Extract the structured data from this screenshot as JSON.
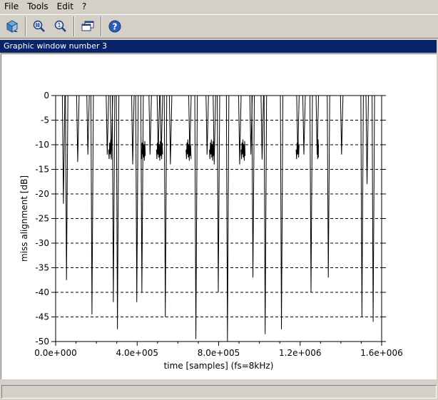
{
  "menu": [
    "File",
    "Tools",
    "Edit",
    "?"
  ],
  "toolbar": {
    "buttons": [
      "rotate-3d-icon",
      "zoom-icon",
      "unzoom-icon",
      "gedit-windows-icon",
      "help-icon"
    ]
  },
  "window_title": "Graphic window number 3",
  "status": "",
  "chart_data": {
    "type": "line",
    "title": "",
    "xlabel": "time [samples] (fs=8kHz)",
    "ylabel": "miss alignment [dB]",
    "xlim": [
      0,
      1600000
    ],
    "ylim": [
      -50,
      0
    ],
    "x_ticks": [
      0,
      400000,
      800000,
      1200000,
      1600000
    ],
    "x_tick_labels": [
      "0.0e+000",
      "4.0e+005",
      "8.0e+005",
      "1.2e+006",
      "1.6e+006"
    ],
    "y_ticks": [
      0,
      -5,
      -10,
      -15,
      -20,
      -25,
      -30,
      -35,
      -40,
      -45,
      -50
    ],
    "y_tick_labels": [
      "0",
      "-5",
      "-10",
      "-15",
      "-20",
      "-25",
      "-30",
      "-35",
      "-40",
      "-45",
      "-50"
    ],
    "grid": "horizontal dashed",
    "series": [
      {
        "color": "#000000",
        "spikes": [
          {
            "x": 40000,
            "min": -22
          },
          {
            "x": 55000,
            "min": -37.5
          },
          {
            "x": 110000,
            "min": -13.5
          },
          {
            "x": 160000,
            "min": -12
          },
          {
            "x": 180000,
            "min": -44.5
          },
          {
            "x": 255000,
            "min": -12
          },
          {
            "x": 275000,
            "min": -13
          },
          {
            "x": 285000,
            "min": -42
          },
          {
            "x": 305000,
            "min": -47.5
          },
          {
            "x": 380000,
            "min": -14
          },
          {
            "x": 400000,
            "min": -42
          },
          {
            "x": 425000,
            "min": -40
          },
          {
            "x": 465000,
            "min": -12
          },
          {
            "x": 505000,
            "min": -12
          },
          {
            "x": 520000,
            "min": -12
          },
          {
            "x": 540000,
            "min": -45
          },
          {
            "x": 565000,
            "min": -14
          },
          {
            "x": 660000,
            "min": -12
          },
          {
            "x": 690000,
            "min": -49.5
          },
          {
            "x": 745000,
            "min": -12
          },
          {
            "x": 780000,
            "min": -14
          },
          {
            "x": 800000,
            "min": -40
          },
          {
            "x": 845000,
            "min": -50
          },
          {
            "x": 905000,
            "min": -14
          },
          {
            "x": 960000,
            "min": -12
          },
          {
            "x": 970000,
            "min": -37
          },
          {
            "x": 1015000,
            "min": -13
          },
          {
            "x": 1030000,
            "min": -48.5
          },
          {
            "x": 1110000,
            "min": -47.5
          },
          {
            "x": 1190000,
            "min": -12
          },
          {
            "x": 1220000,
            "min": -12
          },
          {
            "x": 1255000,
            "min": -40
          },
          {
            "x": 1285000,
            "min": -12
          },
          {
            "x": 1340000,
            "min": -37
          },
          {
            "x": 1405000,
            "min": -12
          },
          {
            "x": 1505000,
            "min": -45
          },
          {
            "x": 1530000,
            "min": -18
          },
          {
            "x": 1560000,
            "min": -46
          }
        ],
        "clusters": [
          {
            "x_start": 260000,
            "x_end": 275000,
            "level": -11
          },
          {
            "x_start": 420000,
            "x_end": 440000,
            "level": -11
          },
          {
            "x_start": 495000,
            "x_end": 525000,
            "level": -11
          },
          {
            "x_start": 640000,
            "x_end": 665000,
            "level": -11
          },
          {
            "x_start": 755000,
            "x_end": 775000,
            "level": -11
          },
          {
            "x_start": 910000,
            "x_end": 930000,
            "level": -11
          },
          {
            "x_start": 1180000,
            "x_end": 1195000,
            "level": -11
          },
          {
            "x_start": 1285000,
            "x_end": 1290000,
            "level": -11
          }
        ]
      }
    ]
  }
}
